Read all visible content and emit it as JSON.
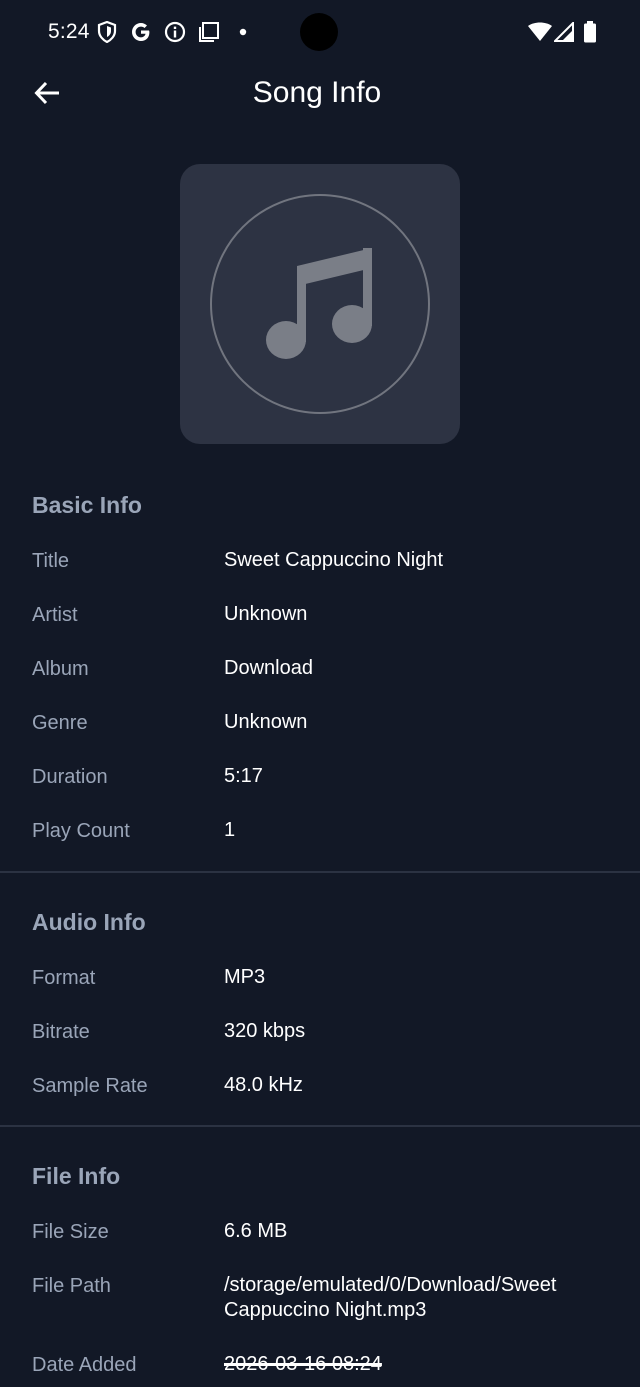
{
  "status_bar": {
    "time": "5:24",
    "icons": [
      "shield-icon",
      "google-icon",
      "info-icon",
      "screenshot-icon",
      "dot-icon",
      "wifi-icon",
      "signal-icon",
      "battery-icon"
    ]
  },
  "app_bar": {
    "back_icon": "back-arrow-icon",
    "title": "Song Info"
  },
  "artwork": {
    "icon": "music-note-icon"
  },
  "basic_info": {
    "title": "Basic Info",
    "rows": [
      {
        "label": "Title",
        "value": "Sweet Cappuccino Night"
      },
      {
        "label": "Artist",
        "value": "Unknown"
      },
      {
        "label": "Album",
        "value": "Download"
      },
      {
        "label": "Genre",
        "value": "Unknown"
      },
      {
        "label": "Duration",
        "value": "5:17"
      },
      {
        "label": "Play Count",
        "value": "1"
      }
    ]
  },
  "audio_info": {
    "title": "Audio Info",
    "rows": [
      {
        "label": "Format",
        "value": "MP3"
      },
      {
        "label": "Bitrate",
        "value": "320 kbps"
      },
      {
        "label": "Sample Rate",
        "value": "48.0 kHz"
      }
    ]
  },
  "file_info": {
    "title": "File Info",
    "rows": [
      {
        "label": "File Size",
        "value": "6.6 MB"
      },
      {
        "label": "File Path",
        "value": "/storage/emulated/0/Download/Sweet Cappuccino Night.mp3"
      },
      {
        "label": "Date Added",
        "value": "2026-03-16 08:24"
      }
    ]
  },
  "colors": {
    "background": "#121826",
    "label": "#9aa5b8",
    "value": "#ffffff",
    "artwork_bg": "#2d3343",
    "divider": "#2b3242"
  }
}
